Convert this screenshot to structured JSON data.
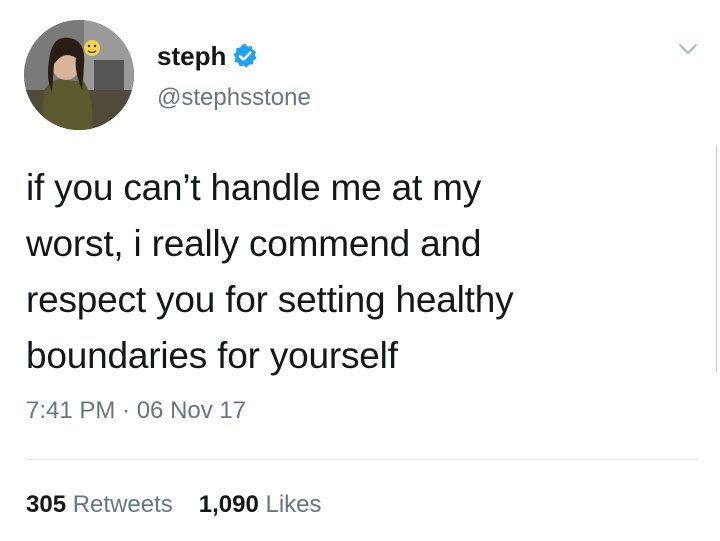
{
  "tweet": {
    "display_name": "steph",
    "verified": true,
    "handle": "@stephsstone",
    "text_lines": [
      "if you can’t handle me at my",
      "worst, i really commend and",
      "respect you for setting healthy",
      "boundaries for yourself"
    ],
    "timestamp": "7:41 PM · 06 Nov 17",
    "retweets": {
      "count": "305",
      "label": "Retweets"
    },
    "likes": {
      "count": "1,090",
      "label": "Likes"
    }
  },
  "colors": {
    "verified_blue": "#1da1f2",
    "secondary_text": "#657786",
    "primary_text": "#14171a",
    "divider": "#e1e8ed"
  },
  "icons": {
    "verified": "verified-badge-icon",
    "menu": "chevron-down-icon"
  }
}
